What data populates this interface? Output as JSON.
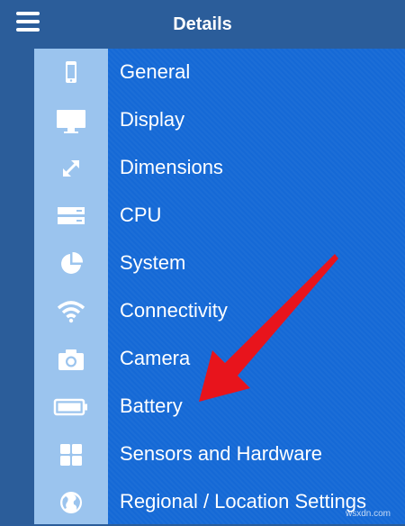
{
  "header": {
    "title": "Details"
  },
  "menu": {
    "items": [
      {
        "label": "General",
        "icon": "phone-icon"
      },
      {
        "label": "Display",
        "icon": "monitor-icon"
      },
      {
        "label": "Dimensions",
        "icon": "resize-arrows-icon"
      },
      {
        "label": "CPU",
        "icon": "server-icon"
      },
      {
        "label": "System",
        "icon": "pie-chart-icon"
      },
      {
        "label": "Connectivity",
        "icon": "wifi-icon"
      },
      {
        "label": "Camera",
        "icon": "camera-icon"
      },
      {
        "label": "Battery",
        "icon": "battery-icon"
      },
      {
        "label": "Sensors and Hardware",
        "icon": "grid-icon"
      },
      {
        "label": "Regional / Location Settings",
        "icon": "globe-icon"
      }
    ]
  },
  "colors": {
    "header_bg": "#2b5d9a",
    "panel_bg": "#1569d6",
    "icon_column_bg": "#9bc4ee",
    "arrow": "#e8141c"
  },
  "watermark": "wsxdn.com"
}
